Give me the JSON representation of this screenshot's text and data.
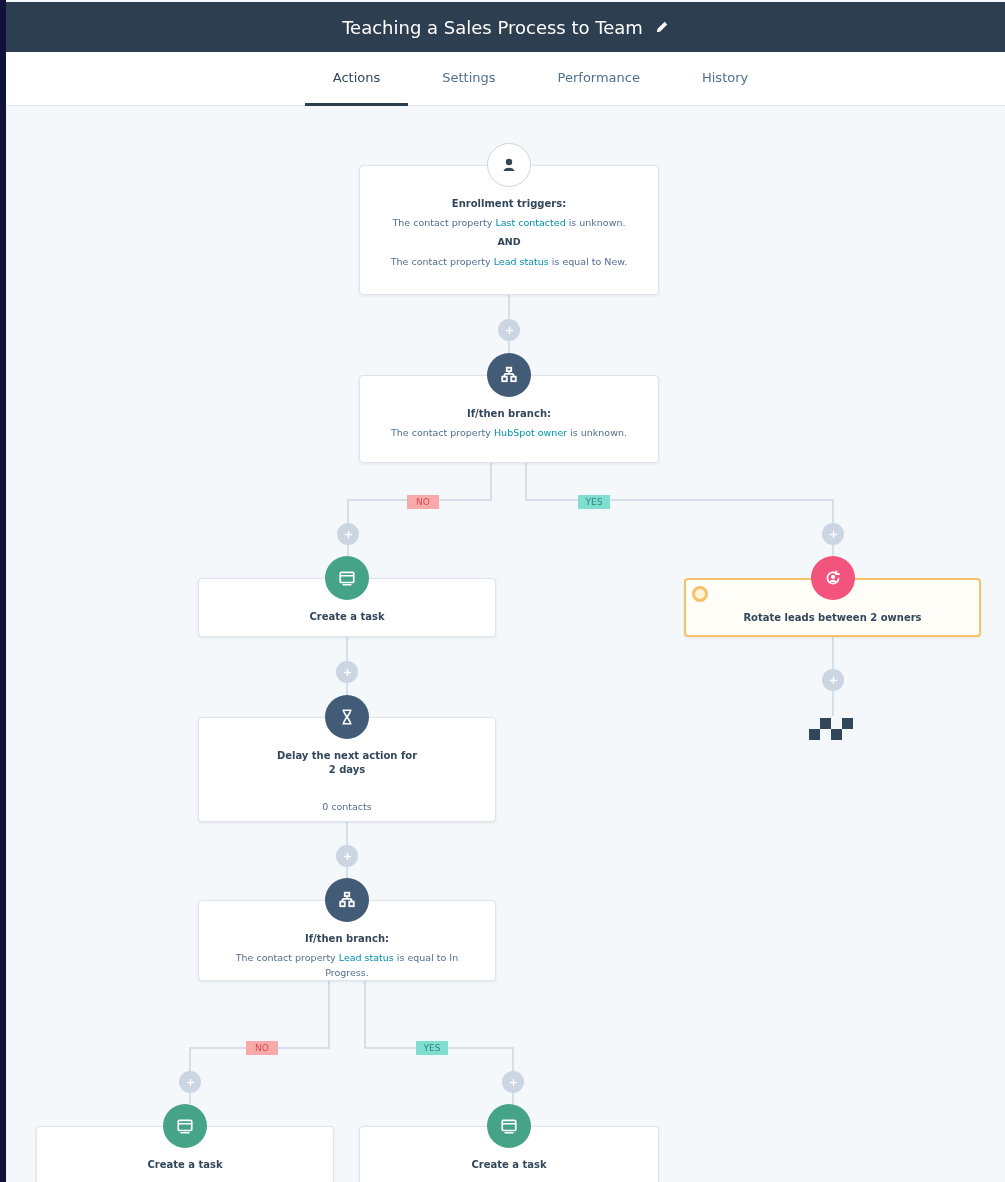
{
  "header": {
    "title": "Teaching a Sales Process to Team"
  },
  "tabs": [
    {
      "label": "Actions",
      "selected": true
    },
    {
      "label": "Settings",
      "selected": false
    },
    {
      "label": "Performance",
      "selected": false
    },
    {
      "label": "History",
      "selected": false
    }
  ],
  "nodes": [
    {
      "kind": "trigger",
      "warning": false,
      "title": "Enrollment triggers:",
      "lines": [
        {
          "kind": "condition",
          "before": "The contact property ",
          "link": "Last contacted",
          "after": " is unknown."
        },
        {
          "kind": "joiner",
          "text": "AND"
        },
        {
          "kind": "condition",
          "before": "The contact property ",
          "link": "Lead status",
          "after": " is equal to New."
        }
      ]
    },
    {
      "kind": "branch",
      "warning": false,
      "title": "If/then branch:",
      "lines": [
        {
          "kind": "condition",
          "before": "The contact property ",
          "link": "HubSpot owner",
          "after": " is unknown."
        }
      ],
      "branches": [
        {
          "kind": "no",
          "label": "NO"
        },
        {
          "kind": "yes",
          "label": "YES"
        }
      ]
    },
    {
      "kind": "task",
      "warning": false,
      "title": "Create a task"
    },
    {
      "kind": "rotate",
      "warning": true,
      "title": "Rotate leads between 2 owners"
    },
    {
      "kind": "delay",
      "warning": false,
      "title": "Delay the next action for 2 days",
      "count": "0 contacts"
    },
    {
      "kind": "branch",
      "warning": false,
      "title": "If/then branch:",
      "lines": [
        {
          "kind": "condition",
          "before": "The contact property ",
          "link": "Lead status",
          "after": " is equal to In Progress."
        }
      ],
      "branches": [
        {
          "kind": "no",
          "label": "NO"
        },
        {
          "kind": "yes",
          "label": "YES"
        }
      ]
    },
    {
      "kind": "task",
      "warning": false,
      "title": "Create a task"
    },
    {
      "kind": "task",
      "warning": false,
      "title": "Create a task"
    }
  ]
}
